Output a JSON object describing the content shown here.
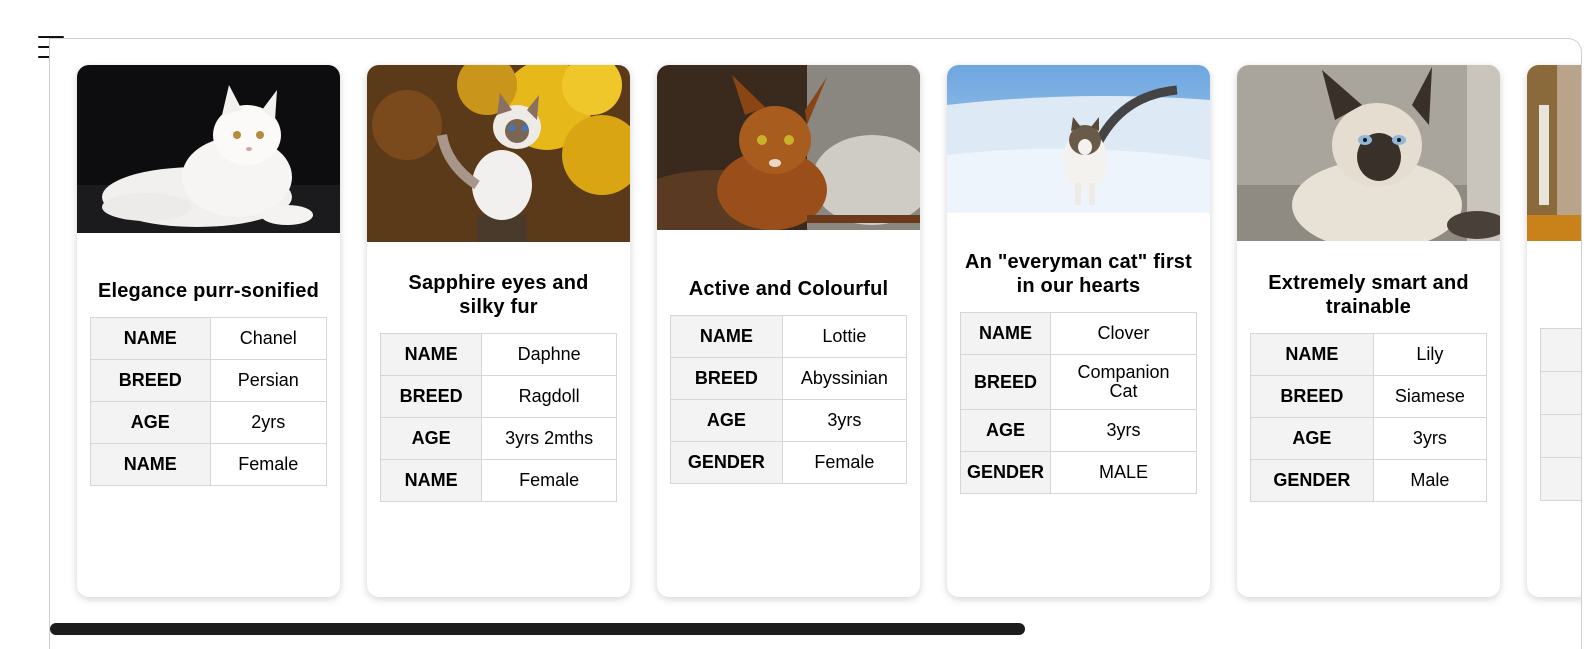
{
  "cards": [
    {
      "title": "Elegance purr-sonified",
      "photo": "white persian cat lying on black background",
      "rows": [
        {
          "k": "NAME",
          "v": "Chanel"
        },
        {
          "k": "BREED",
          "v": "Persian"
        },
        {
          "k": "AGE",
          "v": "2yrs"
        },
        {
          "k": "NAME",
          "v": "Female"
        }
      ]
    },
    {
      "title": "Sapphire eyes and silky fur",
      "photo": "ragdoll kitten on a stump with yellow foliage",
      "rows": [
        {
          "k": "NAME",
          "v": "Daphne"
        },
        {
          "k": "BREED",
          "v": "Ragdoll"
        },
        {
          "k": "AGE",
          "v": "3yrs 2mths"
        },
        {
          "k": "NAME",
          "v": "Female"
        }
      ]
    },
    {
      "title": "Active and Colourful",
      "photo": "abyssinian cat on a knitted blanket",
      "rows": [
        {
          "k": "NAME",
          "v": "Lottie"
        },
        {
          "k": "BREED",
          "v": "Abyssinian"
        },
        {
          "k": "AGE",
          "v": "3yrs"
        },
        {
          "k": "GENDER",
          "v": "Female"
        }
      ]
    },
    {
      "title": "An \"everyman cat\" first in our hearts",
      "photo": "tabby and white cat walking in snow",
      "rows": [
        {
          "k": "NAME",
          "v": "Clover"
        },
        {
          "k": "BREED",
          "v": "Companion Cat"
        },
        {
          "k": "AGE",
          "v": "3yrs"
        },
        {
          "k": "GENDER",
          "v": "MALE"
        }
      ]
    },
    {
      "title": "Extremely smart and trainable",
      "photo": "siamese cat sitting on a grey sofa",
      "rows": [
        {
          "k": "NAME",
          "v": "Lily"
        },
        {
          "k": "BREED",
          "v": "Siamese"
        },
        {
          "k": "AGE",
          "v": "3yrs"
        },
        {
          "k": "GENDER",
          "v": "Male"
        }
      ]
    }
  ]
}
